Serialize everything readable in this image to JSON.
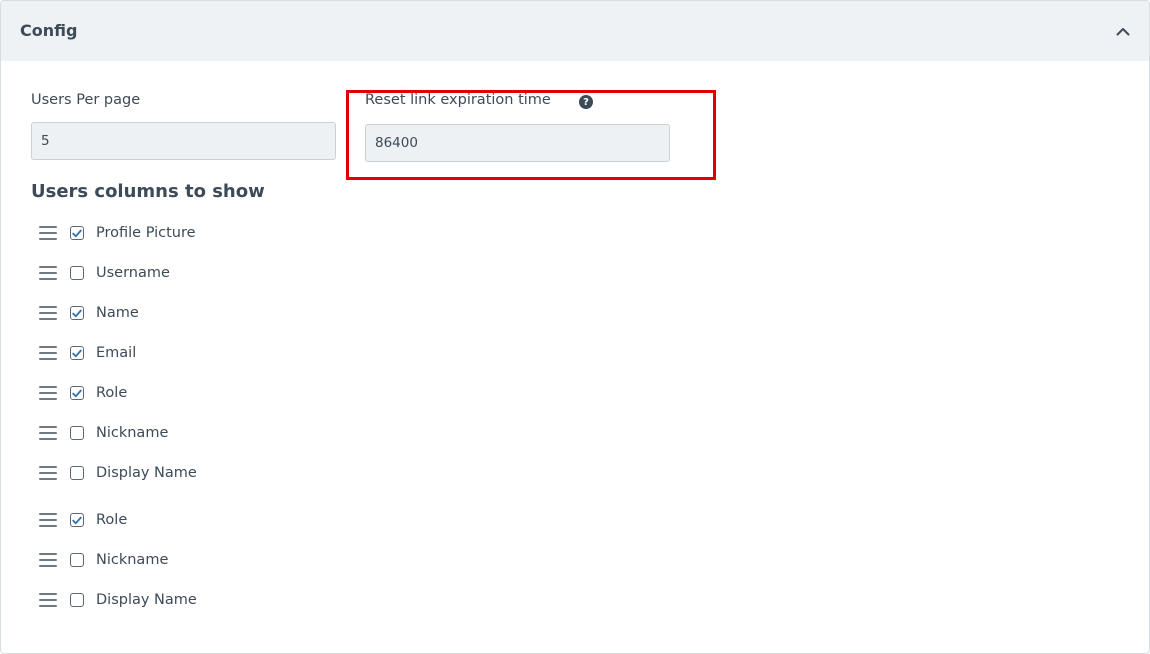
{
  "panel": {
    "title": "Config"
  },
  "users_per_page": {
    "label": "Users Per page",
    "value": "5"
  },
  "reset_link": {
    "label": "Reset link expiration time",
    "value": "86400",
    "help_icon": "question-circle"
  },
  "columns_section": {
    "title": "Users columns to show",
    "items": [
      {
        "label": "Profile Picture",
        "checked": true
      },
      {
        "label": "Username",
        "checked": false
      },
      {
        "label": "Name",
        "checked": true
      },
      {
        "label": "Email",
        "checked": true
      },
      {
        "label": "Role",
        "checked": true
      },
      {
        "label": "Nickname",
        "checked": false
      },
      {
        "label": "Display Name",
        "checked": false
      },
      {
        "label": "Role",
        "checked": true
      },
      {
        "label": "Nickname",
        "checked": false
      },
      {
        "label": "Display Name",
        "checked": false
      }
    ]
  },
  "colors": {
    "highlight": "#e00000",
    "text": "#3d4a57",
    "header_bg": "#eef2f5",
    "input_bg": "#edf1f4"
  }
}
